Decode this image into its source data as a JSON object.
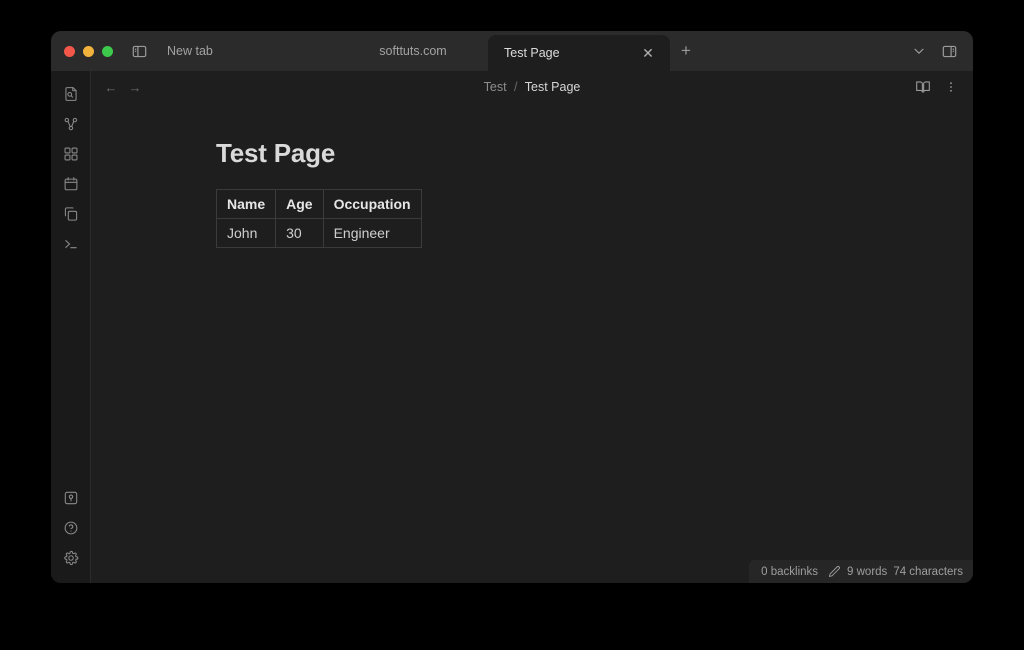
{
  "window": {
    "traffic_lights": [
      "close",
      "minimize",
      "maximize"
    ],
    "sidebar_toggle_icon": "left-sidebar-toggle-icon"
  },
  "tabs": {
    "items": [
      {
        "label": "New tab",
        "active": false,
        "closable": false
      },
      {
        "label": "softtuts.com",
        "active": false,
        "closable": false
      },
      {
        "label": "Test Page",
        "active": true,
        "closable": true
      }
    ],
    "close_glyph": "✕",
    "new_tab_glyph": "+",
    "right_actions": [
      {
        "name": "tab-list-chevron",
        "icon": "chevron-down-icon"
      },
      {
        "name": "right-sidebar-toggle",
        "icon": "right-sidebar-toggle-icon"
      }
    ]
  },
  "ribbon": {
    "top_items": [
      {
        "name": "quick-switcher",
        "icon": "file-search-icon"
      },
      {
        "name": "graph-view",
        "icon": "graph-icon"
      },
      {
        "name": "canvas",
        "icon": "grid-icon"
      },
      {
        "name": "daily-note",
        "icon": "calendar-icon"
      },
      {
        "name": "new-note",
        "icon": "copy-files-icon"
      },
      {
        "name": "terminal",
        "icon": "terminal-icon"
      }
    ],
    "bottom_items": [
      {
        "name": "vault-switcher",
        "icon": "vault-icon"
      },
      {
        "name": "help",
        "icon": "help-circle-icon"
      },
      {
        "name": "settings",
        "icon": "gear-icon"
      }
    ]
  },
  "view_header": {
    "back_glyph": "←",
    "forward_glyph": "→",
    "breadcrumb": {
      "parent": "Test",
      "separator": "/",
      "current": "Test Page"
    },
    "actions": [
      {
        "name": "reading-view",
        "icon": "book-open-icon"
      },
      {
        "name": "more-options",
        "icon": "vertical-dots-icon"
      }
    ]
  },
  "document": {
    "title": "Test Page",
    "table": {
      "headers": [
        "Name",
        "Age",
        "Occupation"
      ],
      "rows": [
        [
          "John",
          "30",
          "Engineer"
        ]
      ]
    }
  },
  "status_bar": {
    "backlinks": "0 backlinks",
    "edit_icon": "pencil-icon",
    "words": "9 words",
    "characters": "74 characters"
  },
  "colors": {
    "desktop_background": "#000000",
    "window_background": "#1e1e1e",
    "tab_bar_background": "#2b2b2b",
    "ribbon_background": "#1a1a1a",
    "status_bar_background": "#262626",
    "text_primary": "#dcdcdc",
    "text_muted": "#8c8c8c",
    "table_border": "#3b3b3b",
    "traffic_close": "#f3574a",
    "traffic_minimize": "#f2b33d",
    "traffic_maximize": "#3dc94b"
  }
}
